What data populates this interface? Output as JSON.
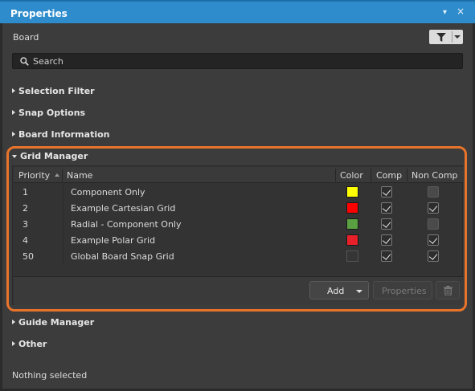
{
  "window": {
    "title": "Properties",
    "pin_glyph": "▾",
    "close_glyph": "×"
  },
  "header": {
    "object_type": "Board",
    "filter_icon": "funnel-icon"
  },
  "search": {
    "placeholder": "Search",
    "icon": "search-icon"
  },
  "sections": {
    "selection_filter": "Selection Filter",
    "snap_options": "Snap Options",
    "board_information": "Board Information",
    "grid_manager": "Grid Manager",
    "guide_manager": "Guide Manager",
    "other": "Other"
  },
  "grid_table": {
    "columns": [
      "Priority",
      "Name",
      "Color",
      "Comp",
      "Non Comp"
    ],
    "sort_column": "Priority",
    "rows": [
      {
        "priority": "1",
        "name": "Component Only",
        "color": "#ffff00",
        "comp": true,
        "non_comp": false
      },
      {
        "priority": "2",
        "name": "Example Cartesian Grid",
        "color": "#ff0000",
        "comp": true,
        "non_comp": true
      },
      {
        "priority": "3",
        "name": "Radial - Component Only",
        "color": "#5aa040",
        "comp": true,
        "non_comp": false
      },
      {
        "priority": "4",
        "name": "Example Polar Grid",
        "color": "#e8202a",
        "comp": true,
        "non_comp": true
      },
      {
        "priority": "50",
        "name": "Global Board Snap Grid",
        "color": "#353535",
        "comp": true,
        "non_comp": true
      }
    ]
  },
  "buttons": {
    "add": "Add",
    "properties": "Properties",
    "delete_icon": "trash-icon"
  },
  "highlight_color": "#e8732a",
  "status": "Nothing selected"
}
